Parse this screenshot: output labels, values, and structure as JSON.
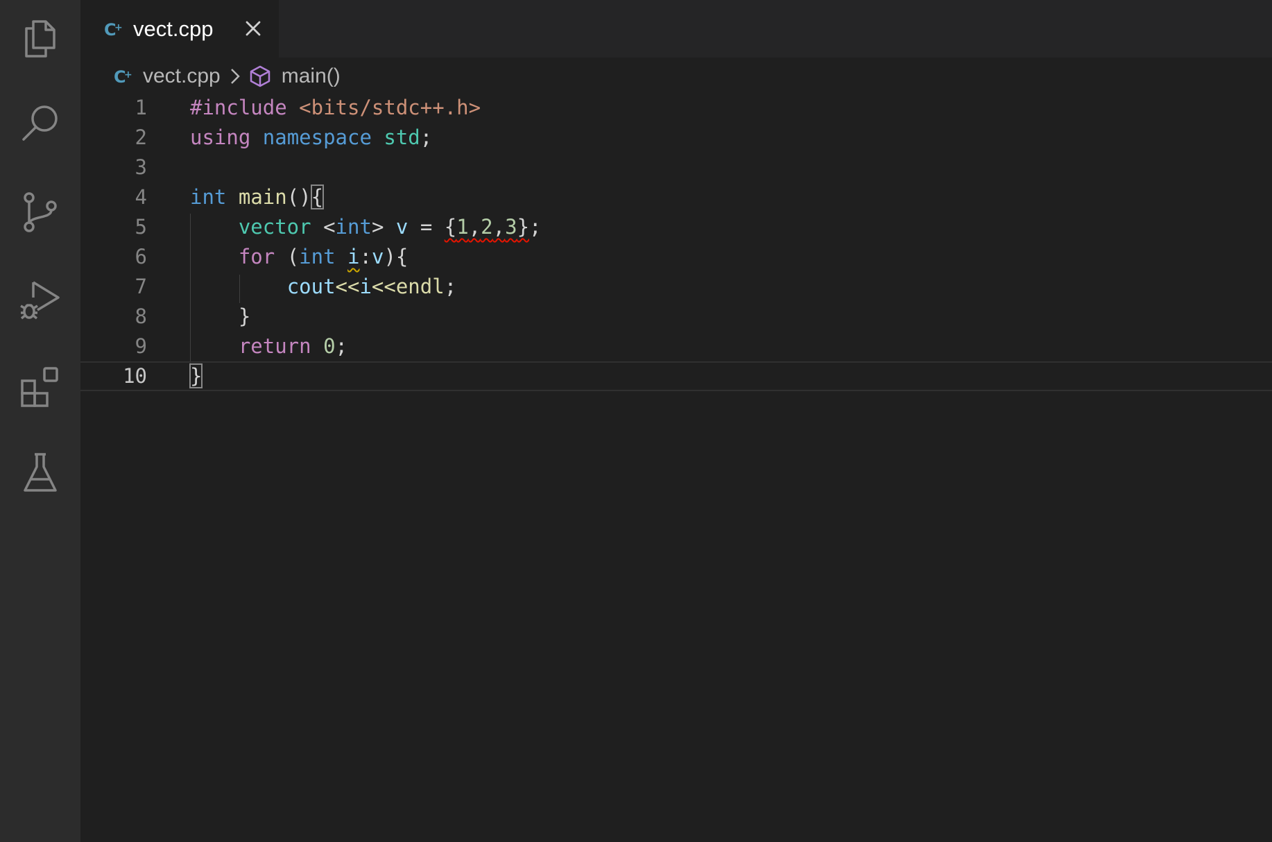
{
  "activity_bar": {
    "items": [
      {
        "name": "explorer-icon"
      },
      {
        "name": "search-icon"
      },
      {
        "name": "source-control-icon"
      },
      {
        "name": "run-debug-icon"
      },
      {
        "name": "extensions-icon"
      },
      {
        "name": "testing-icon"
      }
    ]
  },
  "tab": {
    "label": "vect.cpp",
    "icon": "cpp-file-icon"
  },
  "breadcrumb": {
    "file": "vect.cpp",
    "symbol": "main()"
  },
  "editor": {
    "current_line": 10,
    "lines": [
      {
        "n": "1"
      },
      {
        "n": "2"
      },
      {
        "n": "3"
      },
      {
        "n": "4"
      },
      {
        "n": "5"
      },
      {
        "n": "6"
      },
      {
        "n": "7"
      },
      {
        "n": "8"
      },
      {
        "n": "9"
      },
      {
        "n": "10"
      }
    ],
    "tokens": {
      "l1_directive": "#include",
      "l1_header": "<bits/stdc++.h>",
      "l2_using": "using",
      "l2_namespace": "namespace",
      "l2_std": "std",
      "l2_semi": ";",
      "l4_int": "int",
      "l4_main": "main",
      "l4_parens": "()",
      "l4_brace": "{",
      "l5_vector": "vector",
      "l5_lt": "<",
      "l5_int": "int",
      "l5_gt": ">",
      "l5_v": "v",
      "l5_eq": "=",
      "l5_lb": "{",
      "l5_1": "1",
      "l5_c1": ",",
      "l5_2": "2",
      "l5_c2": ",",
      "l5_3": "3",
      "l5_rb": "}",
      "l5_semi": ";",
      "l6_for": "for",
      "l6_lp": "(",
      "l6_int": "int",
      "l6_i": "i",
      "l6_colon": ":",
      "l6_v": "v",
      "l6_rp": "){",
      "l7_cout": "cout",
      "l7_op1": "<<",
      "l7_i": "i",
      "l7_op2": "<<",
      "l7_endl": "endl",
      "l7_semi": ";",
      "l8_brace": "}",
      "l9_return": "return",
      "l9_zero": "0",
      "l9_semi": ";",
      "l10_brace": "}"
    }
  },
  "colors": {
    "background": "#1f1f1f",
    "activity_bar": "#2c2c2c",
    "keyword_control": "#c586c0",
    "keyword_type": "#569cd6",
    "namespace": "#4ec9b0",
    "function": "#dcdcaa",
    "string": "#ce9178",
    "variable": "#9cdcfe",
    "number": "#b5cea8",
    "error_squiggle": "#e51400",
    "warning_squiggle": "#cca700"
  }
}
